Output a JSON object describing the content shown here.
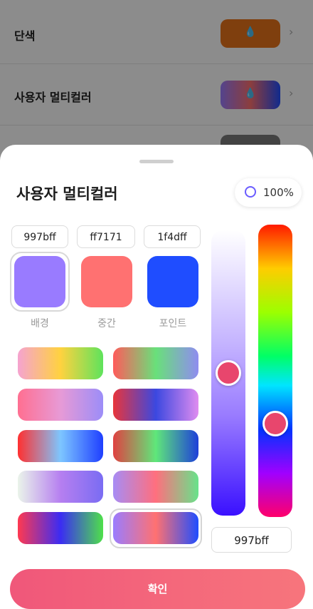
{
  "background_list": {
    "rows": [
      {
        "label": "단색",
        "swatch_color": "#e8741a"
      },
      {
        "label": "사용자 멀티컬러",
        "swatch_gradient": [
          "#997bff",
          "#ff7171",
          "#1f4dff"
        ]
      }
    ],
    "drop_icon": "droplet-icon",
    "chevron_icon": "chevron-right-icon"
  },
  "sheet": {
    "title": "사용자 멀티컬러",
    "opacity": "100%",
    "colors": [
      {
        "hex": "997bff",
        "label": "배경",
        "color": "#997bff"
      },
      {
        "hex": "ff7171",
        "label": "중간",
        "color": "#ff7171"
      },
      {
        "hex": "1f4dff",
        "label": "포인트",
        "color": "#1f4dff"
      }
    ],
    "presets": [
      {
        "gradient": "linear-gradient(90deg,#f5a3d0,#ffd23f,#5ee35c)"
      },
      {
        "gradient": "linear-gradient(90deg,#ff5b5b,#69e07a,#8f8cf0)"
      },
      {
        "gradient": "linear-gradient(90deg,#ff6f91,#e79ad6,#9c8df8)"
      },
      {
        "gradient": "linear-gradient(90deg,#e8353b,#3b48e0,#df8cf0)"
      },
      {
        "gradient": "linear-gradient(90deg,#ff3030,#7dc6ff,#1f3fff)"
      },
      {
        "gradient": "linear-gradient(90deg,#e04141,#5fe77a,#1d3fd9)"
      },
      {
        "gradient": "linear-gradient(90deg,#eaf4ea,#b67ff0,#7a6cf3)"
      },
      {
        "gradient": "linear-gradient(90deg,#a78cf5,#ff6f7e,#67e38a)"
      },
      {
        "gradient": "linear-gradient(90deg,#ff3950,#3b2cf3,#4ee04a)"
      },
      {
        "gradient": "linear-gradient(90deg,#9a7cff,#ff7171,#1f4dff)"
      }
    ],
    "selected_preset": 9,
    "brightness_level": 0.5,
    "hue_level": 0.68,
    "hex_value": "997bff",
    "confirm_label": "확인",
    "accent": "#f0577a"
  }
}
